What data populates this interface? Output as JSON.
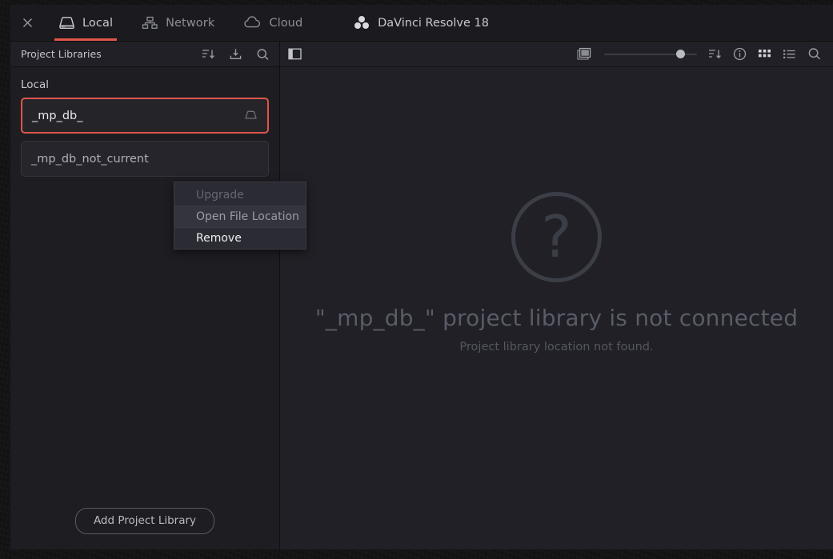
{
  "window": {
    "app_title": "DaVinci Resolve 18",
    "close_icon": "close-icon",
    "logo_icon": "davinci-resolve-logo"
  },
  "tabs": [
    {
      "label": "Local",
      "icon": "hard-drive-icon",
      "active": true
    },
    {
      "label": "Network",
      "icon": "network-icon",
      "active": false
    },
    {
      "label": "Cloud",
      "icon": "cloud-icon",
      "active": false
    }
  ],
  "sidebar_toolbar": {
    "title": "Project Libraries",
    "icons": [
      "sort-icon",
      "import-library-icon",
      "search-icon"
    ]
  },
  "main_toolbar": {
    "icons": [
      "sidebar-toggle-icon",
      "thumbnail-icon",
      "sort-icon",
      "info-icon",
      "grid-view-icon",
      "list-view-icon",
      "search-icon"
    ],
    "zoom_slider_value": 78
  },
  "sidebar": {
    "section_label": "Local",
    "libraries": [
      {
        "name": "_mp_db_",
        "selected": true,
        "badge_icon": "disk-status-icon"
      },
      {
        "name": "_mp_db_not_current",
        "selected": false,
        "badge_icon": ""
      }
    ],
    "add_button_label": "Add Project Library"
  },
  "main": {
    "placeholder_icon": "question-mark-icon",
    "placeholder_glyph": "?",
    "title": "\"_mp_db_\" project library is not connected",
    "subtitle": "Project library location not found."
  },
  "context_menu": {
    "items": [
      {
        "label": "Upgrade",
        "state": "disabled"
      },
      {
        "label": "Open File Location",
        "state": "hover"
      },
      {
        "label": "Remove",
        "state": "strong"
      }
    ]
  },
  "colors": {
    "accent_red": "#e4564a",
    "window_bg": "#202026",
    "sidebar_bg": "#1d1d22",
    "titlebar_bg": "#1b1b1f",
    "menu_bg": "#2b2b33"
  }
}
